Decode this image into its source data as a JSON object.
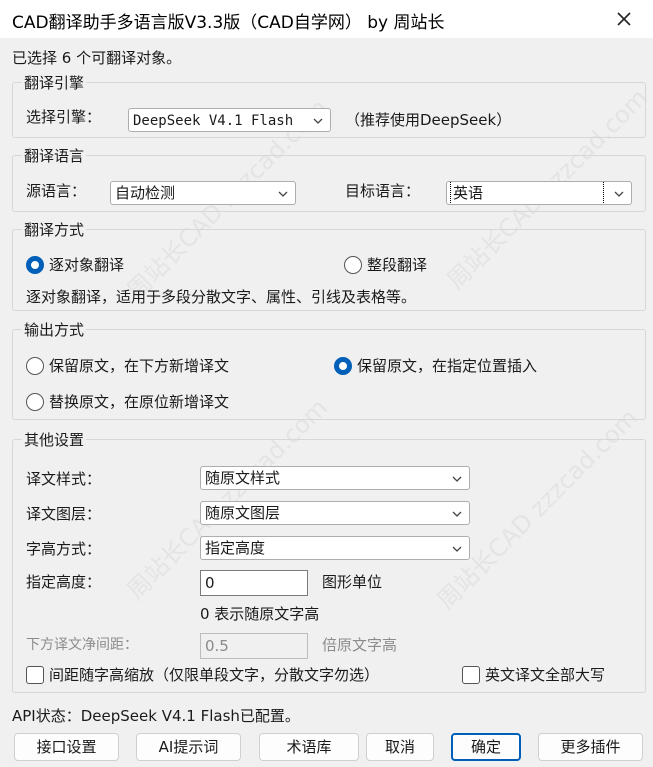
{
  "window": {
    "title": "CAD翻译助手多语言版V3.3版（CAD自学网） by 周站长"
  },
  "status_top": "已选择 6 个可翻译对象。",
  "engine": {
    "group_title": "翻译引擎",
    "label": "选择引擎：",
    "value": "DeepSeek V4.1 Flash",
    "hint": "（推荐使用DeepSeek）"
  },
  "language": {
    "group_title": "翻译语言",
    "source_label": "源语言：",
    "source_value": "自动检测",
    "target_label": "目标语言：",
    "target_value": "英语"
  },
  "mode": {
    "group_title": "翻译方式",
    "option_object": "逐对象翻译",
    "option_paragraph": "整段翻译",
    "selected": "option_object",
    "description": "逐对象翻译，适用于多段分散文字、属性、引线及表格等。"
  },
  "output": {
    "group_title": "输出方式",
    "option_below": "保留原文，在下方新增译文",
    "option_insert": "保留原文，在指定位置插入",
    "option_replace": "替换原文，在原位新增译文",
    "selected": "option_insert"
  },
  "other": {
    "group_title": "其他设置",
    "style_label": "译文样式：",
    "style_value": "随原文样式",
    "layer_label": "译文图层：",
    "layer_value": "随原文图层",
    "height_mode_label": "字高方式：",
    "height_mode_value": "指定高度",
    "height_label": "指定高度：",
    "height_value": "0",
    "height_unit": "图形单位",
    "height_hint": "0 表示随原文字高",
    "spacing_label": "下方译文净间距：",
    "spacing_value": "0.5",
    "spacing_unit": "倍原文字高",
    "scale_check": "间距随字高缩放（仅限单段文字，分散文字勿选）",
    "upper_check": "英文译文全部大写"
  },
  "status_bottom": "API状态：DeepSeek V4.1 Flash已配置。",
  "buttons": {
    "api": "接口设置",
    "prompt": "AI提示词",
    "glossary": "术语库",
    "cancel": "取消",
    "ok": "确定",
    "plugins": "更多插件"
  },
  "watermark": "周站长CAD zzzcad.com",
  "colors": {
    "accent": "#005fb8",
    "background": "#f0f0f0"
  }
}
